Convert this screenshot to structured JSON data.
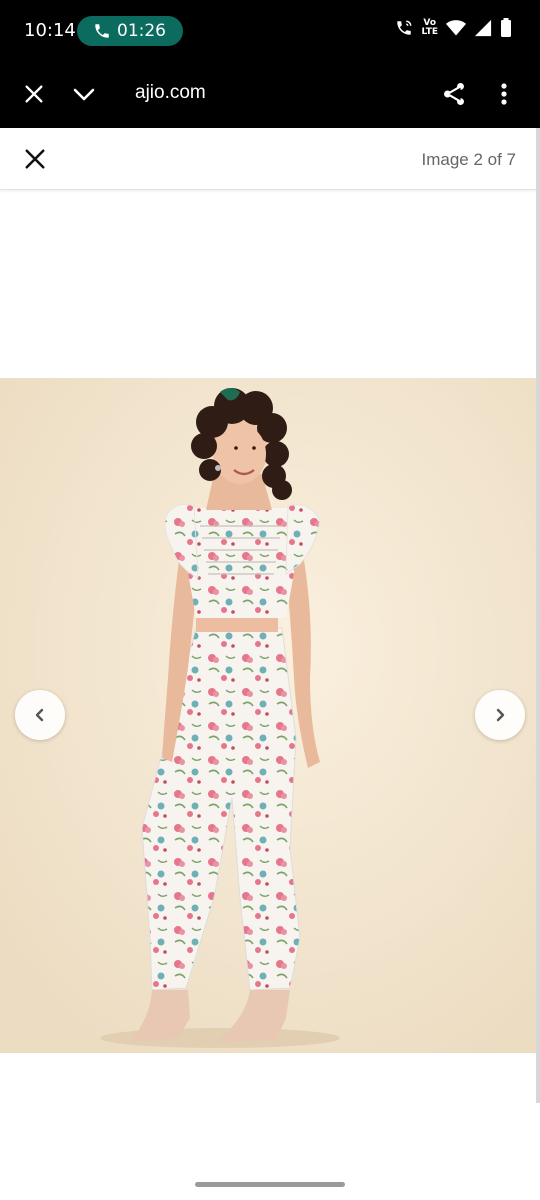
{
  "status_bar": {
    "time": "10:14",
    "call_duration": "01:26",
    "volte_top": "Vo",
    "volte_bottom": "LTE"
  },
  "browser": {
    "url": "ajio.com",
    "close_icon": "close-icon",
    "minimize_icon": "chevron-down-icon",
    "share_icon": "share-icon",
    "menu_icon": "more-vert-icon"
  },
  "gallery": {
    "counter": "Image 2 of 7",
    "close_icon": "close-icon",
    "prev_icon": "chevron-left-icon",
    "next_icon": "chevron-right-icon"
  },
  "colors": {
    "call_pill": "#0b6b5e",
    "bar_bg": "#000000",
    "photo_bg": "#f3e6d0"
  }
}
